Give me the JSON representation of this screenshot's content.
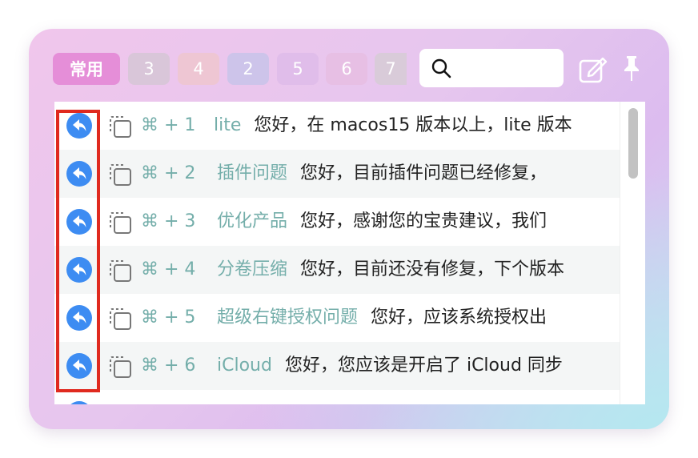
{
  "tabs": [
    {
      "label": "常用",
      "active": true
    },
    {
      "label": "3"
    },
    {
      "label": "4"
    },
    {
      "label": "2"
    },
    {
      "label": "5"
    },
    {
      "label": "6"
    },
    {
      "label": "7"
    }
  ],
  "search": {
    "placeholder": "",
    "value": "",
    "icon": "search-icon"
  },
  "toolbar": {
    "edit_icon": "edit-icon",
    "pin_icon": "pin-icon"
  },
  "colors": {
    "accent_text": "#74aeaa",
    "reply_icon": "#3d8cf2",
    "highlight_border": "#e02a1f",
    "active_tab": "#e58ed8"
  },
  "items": [
    {
      "shortcut": "⌘ + 1",
      "title": "lite",
      "body": "您好，在 macos15 版本以上，lite 版本"
    },
    {
      "shortcut": "⌘ + 2",
      "title": "插件问题",
      "body": "您好，目前插件问题已经修复，"
    },
    {
      "shortcut": "⌘ + 3",
      "title": "优化产品",
      "body": "您好，感谢您的宝贵建议，我们"
    },
    {
      "shortcut": "⌘ + 4",
      "title": "分卷压缩",
      "body": "您好，目前还没有修复，下个版本"
    },
    {
      "shortcut": "⌘ + 5",
      "title": "超级右键授权问题",
      "body": "您好，应该系统授权出"
    },
    {
      "shortcut": "⌘ + 6",
      "title": "iCloud",
      "body": "您好，您应该是开启了 iCloud 同步"
    }
  ]
}
